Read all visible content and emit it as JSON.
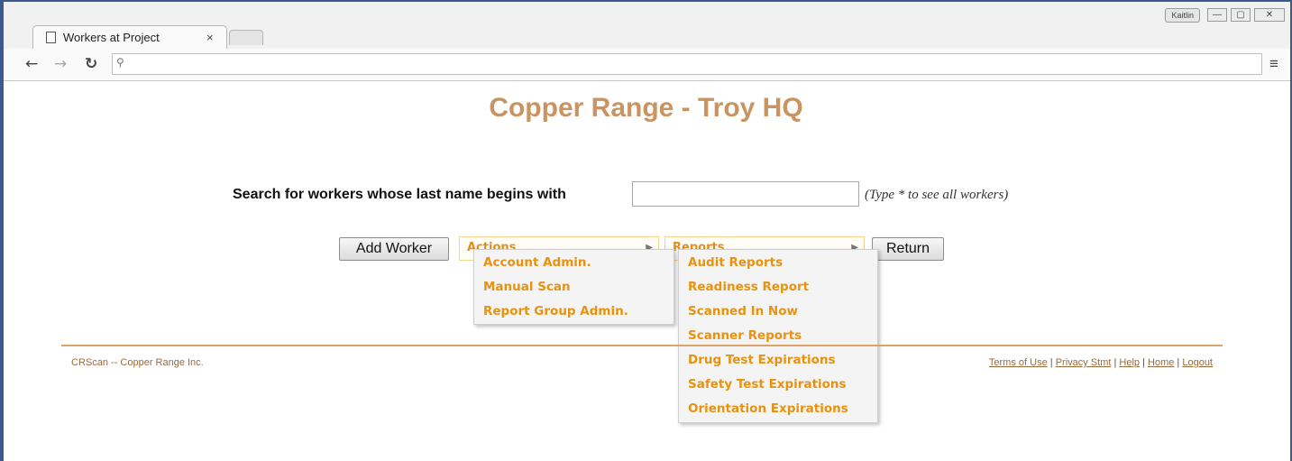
{
  "browser": {
    "tab_title": "Workers at Project",
    "tab_close": "×",
    "user_badge": "Kaitlin",
    "minimize": "—",
    "maximize": "▢",
    "close": "✕",
    "address": "",
    "icons": [
      "back-arrow-icon",
      "forward-arrow-icon",
      "reload-icon",
      "search-icon",
      "menu-icon"
    ]
  },
  "page": {
    "title": "Copper Range - Troy HQ",
    "search_label": "Search for workers whose last name begins with",
    "search_value": "",
    "search_hint": "(Type * to see all workers)",
    "add_worker": "Add Worker",
    "actions_label": "Actions",
    "reports_label": "Reports",
    "return_label": "Return"
  },
  "actions_menu": {
    "items": [
      "Account Admin.",
      "Manual Scan",
      "Report Group Admin."
    ]
  },
  "reports_menu": {
    "items": [
      "Audit Reports",
      "Readiness Report",
      "Scanned In Now",
      "Scanner Reports",
      "Drug Test Expirations",
      "Safety Test Expirations",
      "Orientation Expirations"
    ]
  },
  "footer": {
    "left": "CRScan -- Copper Range Inc.",
    "links": [
      "Terms of Use",
      "Privacy Stmt",
      "Help",
      "Home",
      "Logout"
    ],
    "separator": " | "
  },
  "colors": {
    "title": "#c99462",
    "menu_text": "#e8920e",
    "footer_line": "#dba36a",
    "window_frame": "#3b5b8c"
  }
}
